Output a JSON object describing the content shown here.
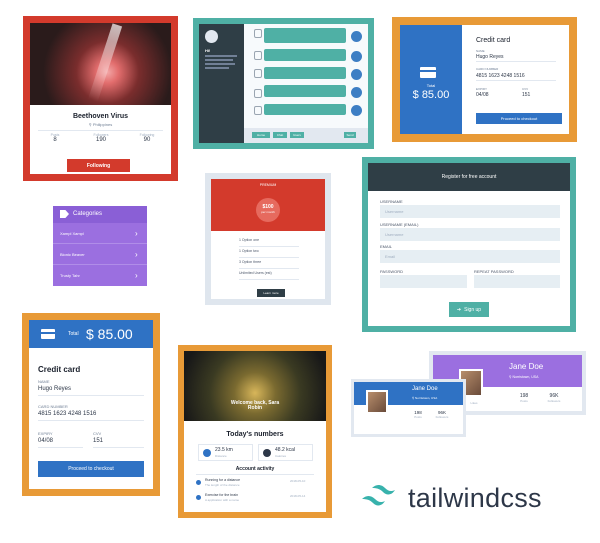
{
  "colors": {
    "red": "#d33a2c",
    "teal": "#4fb0a5",
    "orange": "#e89a37",
    "blue": "#2f72c4",
    "purple": "#9b6fe0",
    "dark": "#2f3e46"
  },
  "music_card": {
    "title": "Beethoven Virus",
    "location": "Philippines",
    "stats": [
      {
        "label": "Posts",
        "value": "8"
      },
      {
        "label": "Followers",
        "value": "190"
      },
      {
        "label": "Following",
        "value": "90"
      }
    ],
    "button": "Following"
  },
  "chat_card": {
    "name": "Hi!",
    "toolbar": [
      "Home",
      "Chat",
      "Users"
    ],
    "send": "Send"
  },
  "credit_small": {
    "total_label": "Total",
    "amount": "$ 85.00",
    "title": "Credit card",
    "name_label": "NAME",
    "name": "Hugo Reyes",
    "card_label": "CARD NUMBER",
    "card_number": "4815 1623 4248 1516",
    "expiry_label": "EXPIRY",
    "expiry": "04/08",
    "cvv_label": "CVV",
    "cvv": "151",
    "button": "Proceed to checkout"
  },
  "pricing_card": {
    "plan": "PREMIUM",
    "price": "$100",
    "period": "per month",
    "features": [
      "1  Option one",
      "1  Option two",
      "3  Option three",
      "Unlimited  Users (est)"
    ],
    "button": "Learn more"
  },
  "categories_card": {
    "title": "Categories",
    "items": [
      "Xampl Xampl",
      "Bionic Beaver",
      "Trusty Tahr"
    ]
  },
  "register_card": {
    "title": "Register for free account",
    "fields": [
      {
        "label": "USERNAME",
        "placeholder": "Username"
      },
      {
        "label": "USERNAME (EMAIL)",
        "placeholder": "Username"
      },
      {
        "label": "EMAIL",
        "placeholder": "Email"
      }
    ],
    "password_label": "PASSWORD",
    "repeat_label": "REPEAT PASSWORD",
    "button": "Sign up"
  },
  "credit_big": {
    "total_label": "Total",
    "amount": "$ 85.00",
    "title": "Credit card",
    "name_label": "NAME",
    "name": "Hugo Reyes",
    "card_label": "CARD NUMBER",
    "card_number": "4815 1623 4248 1516",
    "expiry_label": "EXPIRY",
    "expiry": "04/08",
    "cvv_label": "CVV",
    "cvv": "151",
    "button": "Proceed to checkout"
  },
  "numbers_card": {
    "heading": "Welcome back, Sara Robin",
    "title": "Today's numbers",
    "stats": [
      {
        "value": "23.5 km",
        "label": "Distance"
      },
      {
        "value": "48.2 kcal",
        "label": "Calories"
      }
    ],
    "activity_title": "Account activity",
    "activities": [
      {
        "title": "Running for a distance",
        "sub": "The length of the distance",
        "date": "2018-05-10"
      },
      {
        "title": "Exercise for the brain",
        "sub": "A application with a name",
        "date": "2018-05-14"
      }
    ]
  },
  "profile_big": {
    "name": "Jane Doe",
    "location": "Norristown, USA",
    "stats": [
      {
        "value": "198",
        "label": "Posts"
      },
      {
        "value": "96K",
        "label": "Followers"
      },
      {
        "value": "",
        "label": "Likes"
      }
    ]
  },
  "profile_small": {
    "name": "Jane Doe",
    "location": "Norristown, USA",
    "stats": [
      {
        "value": "198",
        "label": "Posts"
      },
      {
        "value": "96K",
        "label": "Followers"
      }
    ]
  },
  "brand": {
    "name": "tailwindcss"
  }
}
